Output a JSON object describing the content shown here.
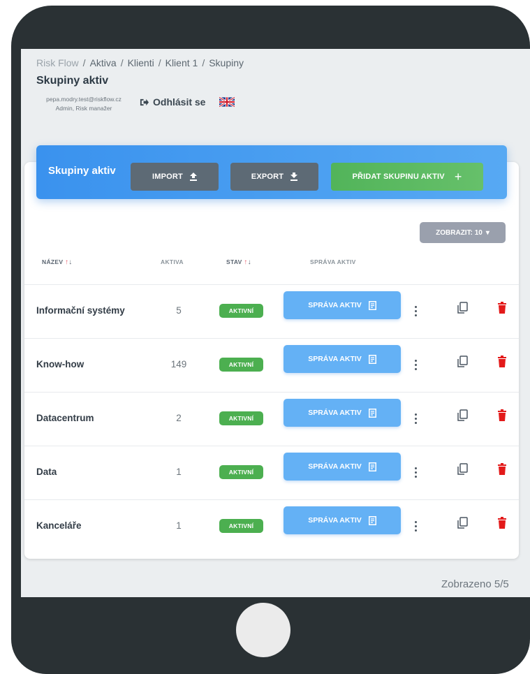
{
  "breadcrumb": {
    "items": [
      "Risk Flow",
      "Aktiva",
      "Klienti",
      "Klient 1",
      "Skupiny"
    ],
    "separator": "/"
  },
  "page": {
    "title": "Skupiny aktiv"
  },
  "user": {
    "email": "pepa.modry.test@riskflow.cz",
    "role": "Admin, Risk manažer",
    "logout_label": "Odhlásit se",
    "language_flag": "uk-flag-icon"
  },
  "card": {
    "title": "Skupiny aktiv",
    "import_label": "IMPORT",
    "export_label": "EXPORT",
    "add_label": "PŘIDAT SKUPINU AKTIV",
    "add_symbol": "+",
    "show_label": "ZOBRAZIT: 10",
    "show_caret": "▾"
  },
  "table": {
    "columns": [
      {
        "label": "NÁZEV",
        "sortable": true
      },
      {
        "label": "AKTIVA",
        "sortable": false
      },
      {
        "label": "STAV",
        "sortable": true
      },
      {
        "label": "SPRÁVA AKTIV",
        "sortable": false
      }
    ],
    "sort_up": "↑",
    "sort_down": "↓",
    "rows": [
      {
        "name": "Informační systémy",
        "count": "5",
        "status": "AKTIVNÍ",
        "action": "SPRÁVA AKTIV"
      },
      {
        "name": "Know-how",
        "count": "149",
        "status": "AKTIVNÍ",
        "action": "SPRÁVA AKTIV"
      },
      {
        "name": "Datacentrum",
        "count": "2",
        "status": "AKTIVNÍ",
        "action": "SPRÁVA AKTIV"
      },
      {
        "name": "Data",
        "count": "1",
        "status": "AKTIVNÍ",
        "action": "SPRÁVA AKTIV"
      },
      {
        "name": "Kanceláře",
        "count": "1",
        "status": "AKTIVNÍ",
        "action": "SPRÁVA AKTIV"
      }
    ]
  },
  "footer": {
    "count_text": "Zobrazeno 5/5"
  },
  "colors": {
    "device": "#2a3134",
    "primary": "#3d96ef",
    "success": "#4caf50",
    "danger": "#e31a1a",
    "dark_button": "#5d6a75"
  }
}
